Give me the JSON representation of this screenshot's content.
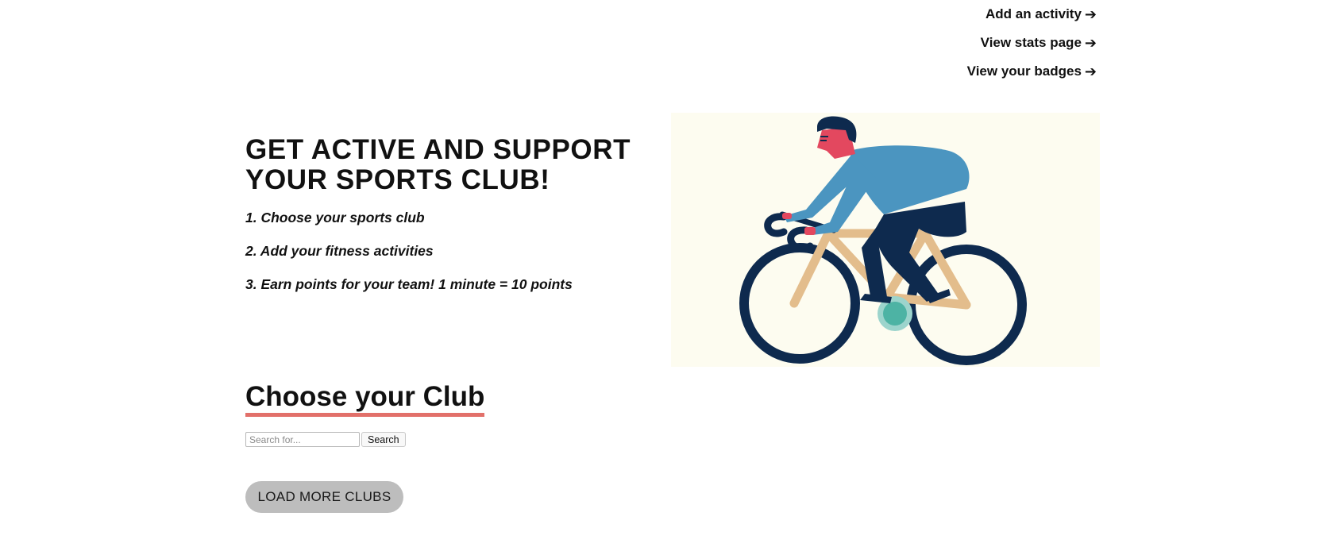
{
  "nav": {
    "links": [
      {
        "label": "Add an activity",
        "icon": "arrow-right-icon"
      },
      {
        "label": "View stats page",
        "icon": "arrow-right-icon"
      },
      {
        "label": "View your badges",
        "icon": "arrow-right-icon"
      }
    ]
  },
  "hero": {
    "title": "GET ACTIVE AND SUPPORT YOUR SPORTS CLUB!",
    "steps": [
      "1. Choose your sports club",
      "2. Add your fitness activities",
      "3. Earn points for your team! 1 minute = 10 points"
    ],
    "illustration": "cyclist-illustration"
  },
  "clubs": {
    "title": "Choose your Club",
    "search_placeholder": "Search for...",
    "search_button": "Search",
    "load_more": "LOAD MORE CLUBS"
  },
  "colors": {
    "accent_underline": "#e2706a",
    "illustration_bg": "#fdfcf0",
    "load_more_bg": "#bdbdbd"
  }
}
